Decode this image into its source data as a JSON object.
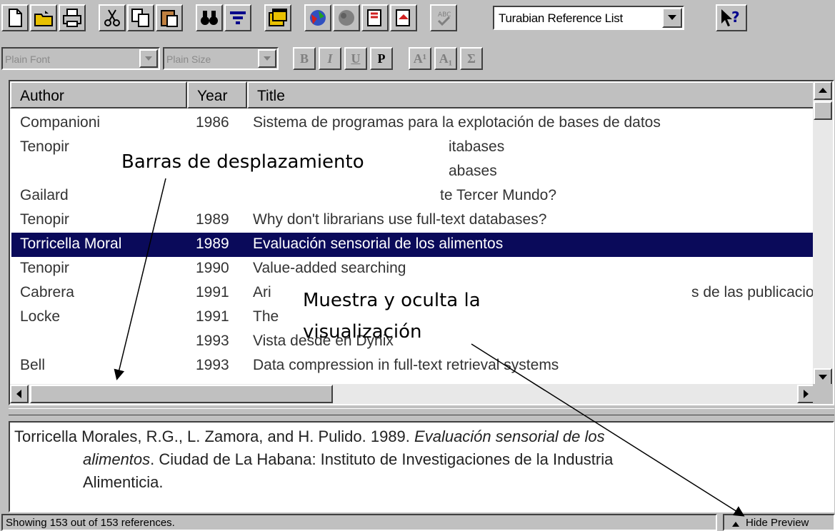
{
  "toolbar": {
    "buttons": [
      {
        "name": "new-document-icon"
      },
      {
        "name": "open-folder-icon"
      },
      {
        "name": "print-icon"
      },
      {
        "name": "cut-icon"
      },
      {
        "name": "copy-icon"
      },
      {
        "name": "paste-icon"
      },
      {
        "name": "find-binoculars-icon"
      },
      {
        "name": "sort-icon"
      },
      {
        "name": "window-icon"
      },
      {
        "name": "import-icon"
      },
      {
        "name": "library-icon"
      },
      {
        "name": "insert-citation-icon"
      },
      {
        "name": "format-bibliography-icon"
      },
      {
        "name": "spell-check-icon"
      }
    ],
    "style_combo": "Turabian Reference List"
  },
  "format_toolbar": {
    "font_combo": "Plain Font",
    "size_combo": "Plain Size",
    "buttons": [
      "B",
      "I",
      "U",
      "P",
      "A¹",
      "A₁",
      "Σ"
    ]
  },
  "list": {
    "columns": [
      "Author",
      "Year",
      "Title"
    ],
    "rows": [
      {
        "author": "Companioni",
        "year": "1986",
        "title": "Sistema de programas para la explotación de bases de datos"
      },
      {
        "author": "Tenopir",
        "year": "",
        "title": "itabases"
      },
      {
        "author": "",
        "year": "",
        "title": "abases"
      },
      {
        "author": "Gailard",
        "year": "",
        "title": "te Tercer Mundo?"
      },
      {
        "author": "Tenopir",
        "year": "1989",
        "title": "Why don't librarians use full-text databases?"
      },
      {
        "author": "Torricella Moral",
        "year": "1989",
        "title": "Evaluación sensorial de los alimentos",
        "selected": true
      },
      {
        "author": "Tenopir",
        "year": "1990",
        "title": "Value-added searching"
      },
      {
        "author": "Cabrera",
        "year": "1991",
        "title": "Ari",
        "tail": "s de las publicacio"
      },
      {
        "author": "Locke",
        "year": "1991",
        "title": "The"
      },
      {
        "author": "",
        "year": "1993",
        "title": "Vista desde en Dynix"
      },
      {
        "author": "Bell",
        "year": "1993",
        "title": "Data compression in full-text retrieval systems"
      }
    ]
  },
  "preview": {
    "line1": "Torricella Morales, R.G., L. Zamora, and H. Pulido. 1989.",
    "title_italic": "Evaluación sensorial de los",
    "line2_italic": "alimentos",
    "line2_rest": ". Ciudad de La Habana: Instituto de Investigaciones de la Industria",
    "line3": "Alimenticia."
  },
  "status": {
    "text": "Showing 153 out of 153 references.",
    "hide_preview": "Hide Preview"
  },
  "annotations": {
    "scrollbars": "Barras de desplazamiento",
    "toggle_line1": "Muestra y oculta la",
    "toggle_line2": "visualización"
  }
}
